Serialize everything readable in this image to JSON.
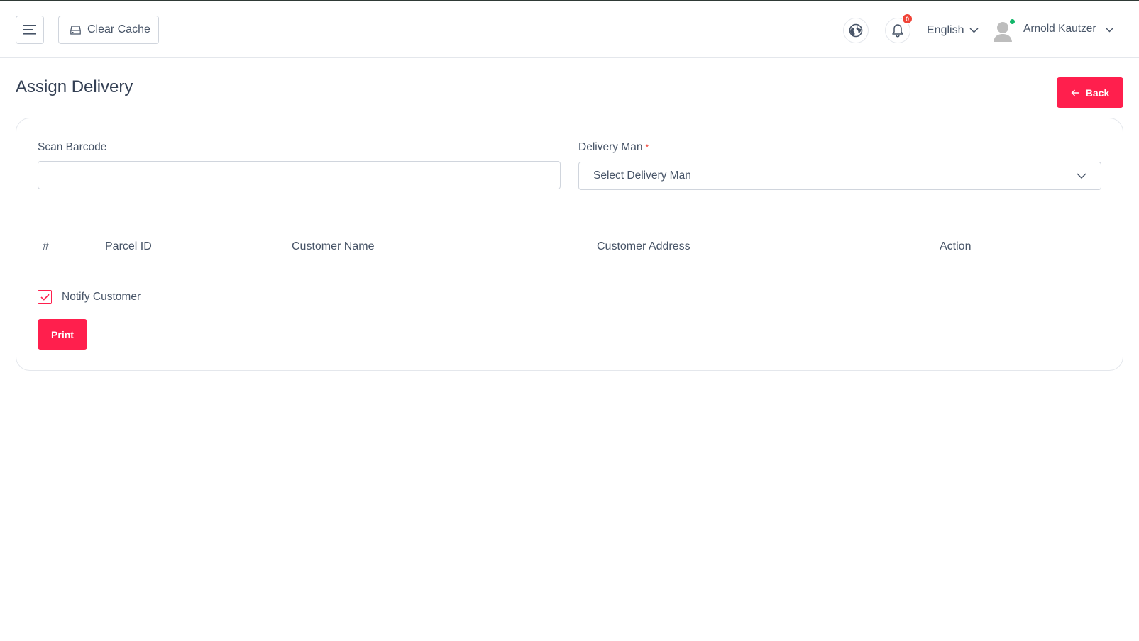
{
  "header": {
    "clear_cache_label": "Clear Cache",
    "notification_count": "0",
    "language": "English",
    "user_name": "Arnold Kautzer"
  },
  "page": {
    "title": "Assign Delivery",
    "back_label": "Back"
  },
  "form": {
    "scan_barcode_label": "Scan Barcode",
    "scan_barcode_value": "",
    "delivery_man_label": "Delivery Man",
    "required_mark": "*",
    "delivery_man_placeholder": "Select Delivery Man"
  },
  "table": {
    "columns": [
      "#",
      "Parcel ID",
      "Customer Name",
      "Customer Address",
      "Action"
    ],
    "rows": []
  },
  "notify": {
    "label": "Notify Customer",
    "checked": true
  },
  "print_label": "Print",
  "colors": {
    "accent": "#ff1f4d",
    "badge": "#f04438",
    "online": "#12b76a"
  }
}
